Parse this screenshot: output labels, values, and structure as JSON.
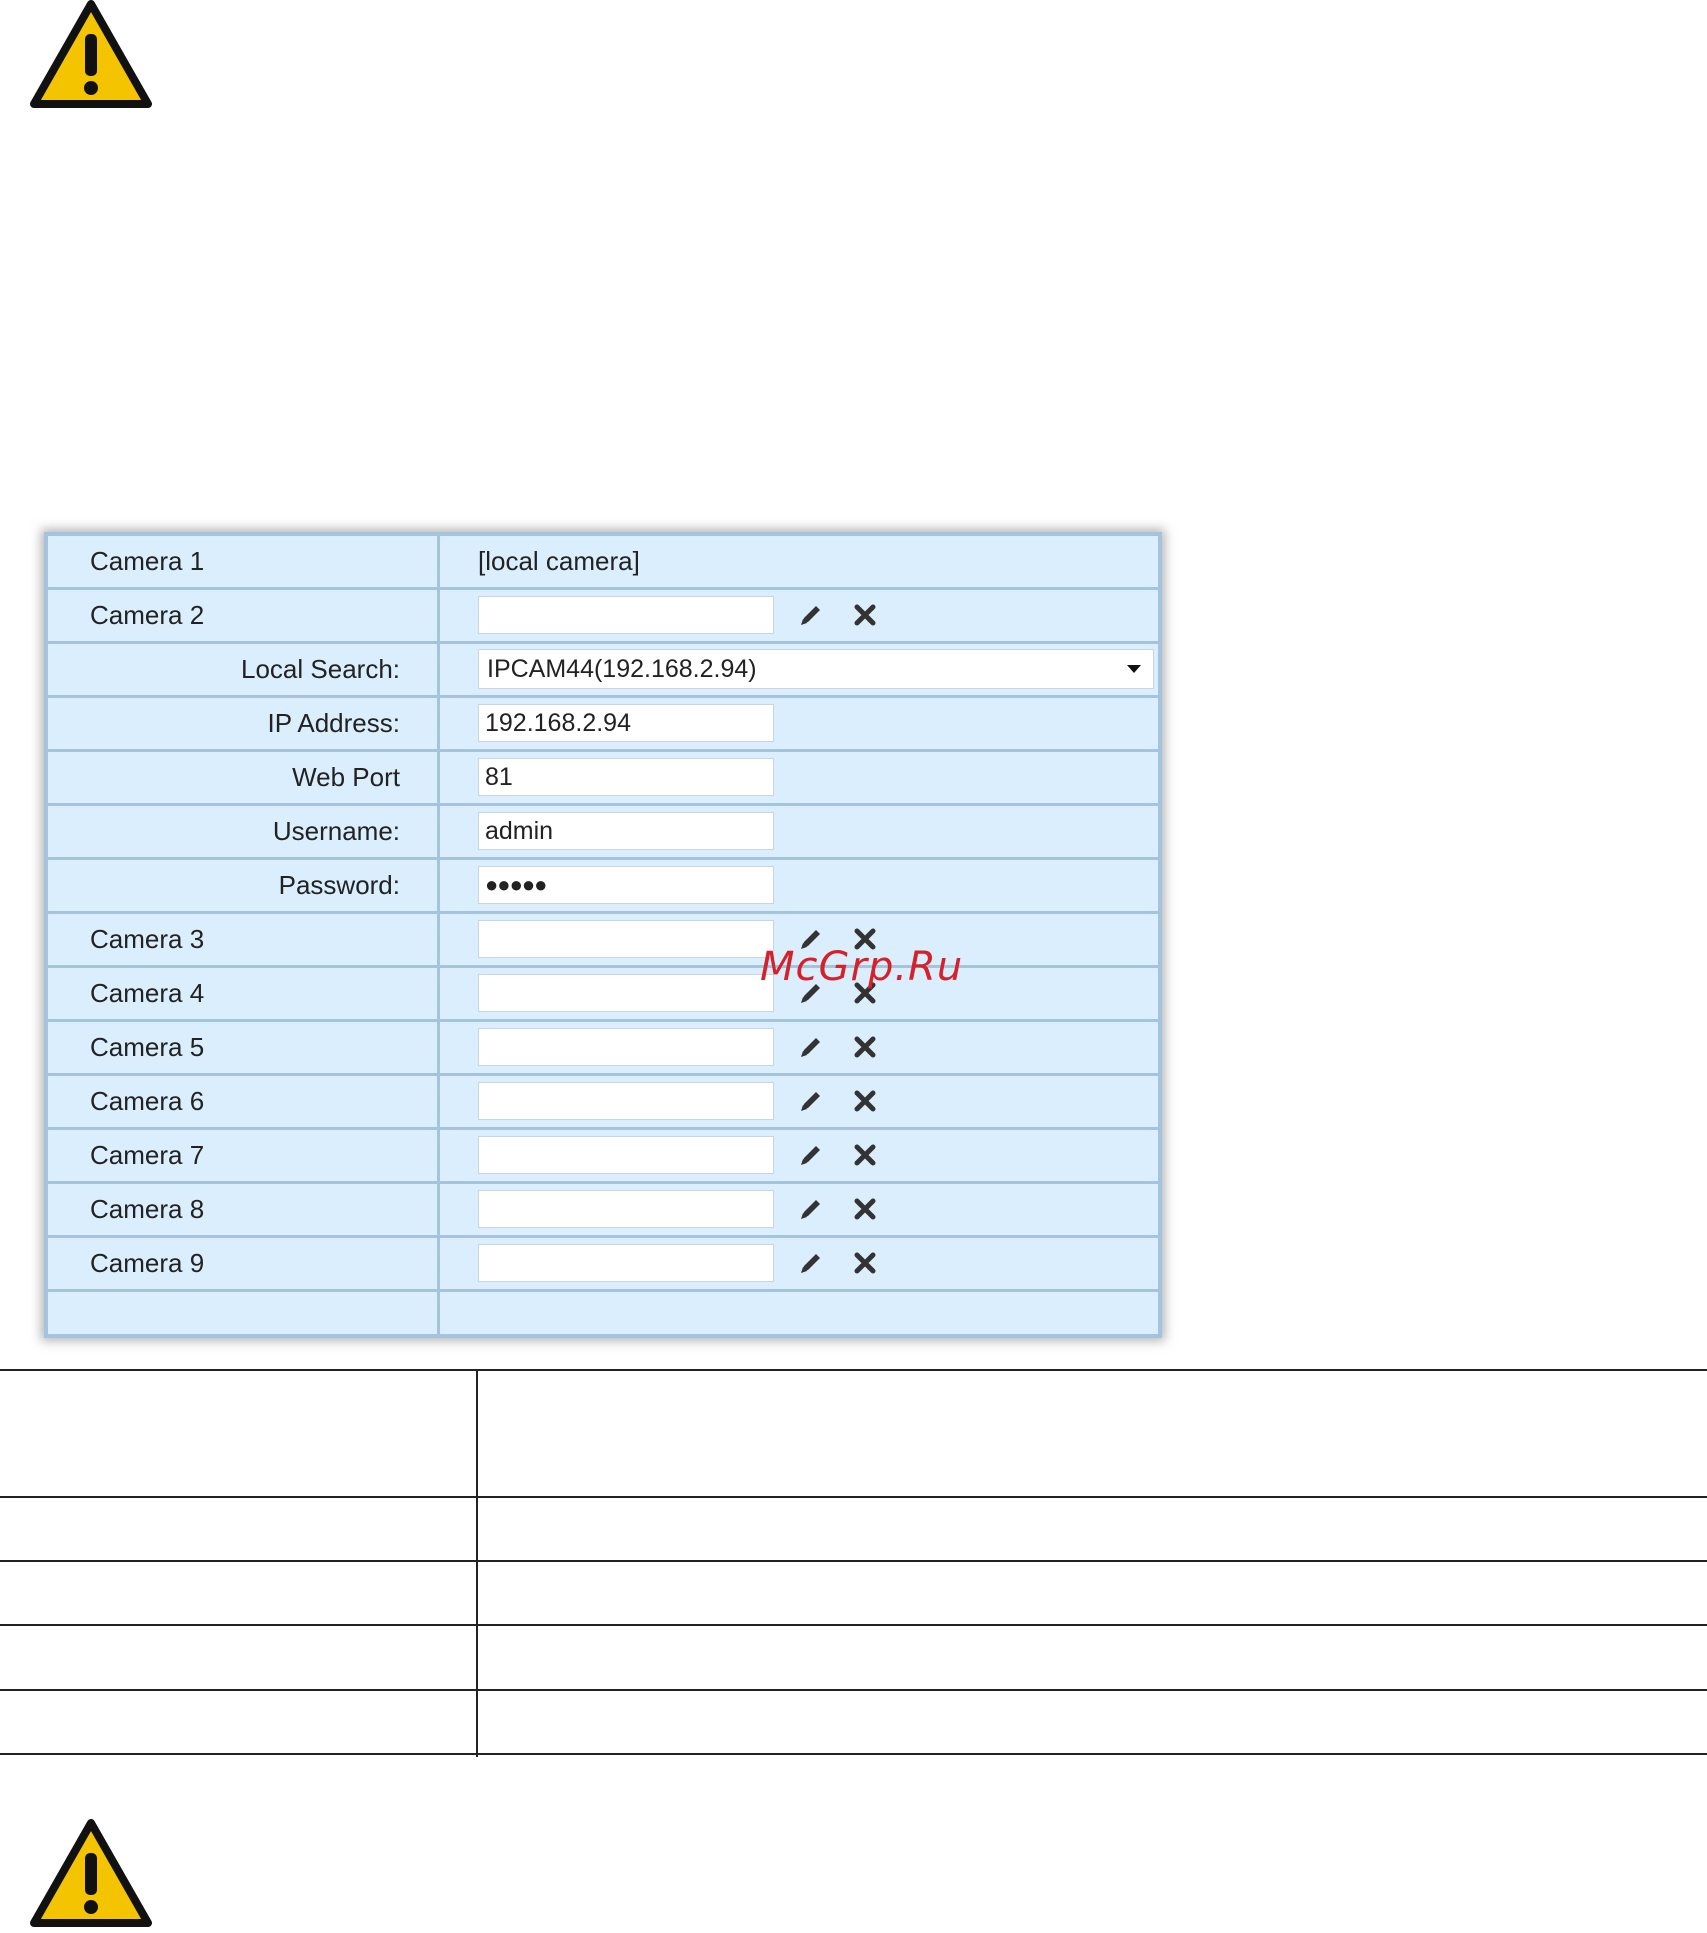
{
  "cameras_panel": {
    "camera1": {
      "label": "Camera 1",
      "value": "[local camera]"
    },
    "camera2": {
      "label": "Camera 2",
      "value": ""
    },
    "local_search": {
      "label": "Local Search:",
      "selected": "IPCAM44(192.168.2.94)"
    },
    "ip_address": {
      "label": "IP Address:",
      "value": "192.168.2.94"
    },
    "web_port": {
      "label": "Web Port",
      "value": "81"
    },
    "username": {
      "label": "Username:",
      "value": "admin"
    },
    "password": {
      "label": "Password:",
      "value": "●●●●●"
    },
    "other_cameras": [
      {
        "label": "Camera 3",
        "value": ""
      },
      {
        "label": "Camera 4",
        "value": ""
      },
      {
        "label": "Camera 5",
        "value": ""
      },
      {
        "label": "Camera 6",
        "value": ""
      },
      {
        "label": "Camera 7",
        "value": ""
      },
      {
        "label": "Camera 8",
        "value": ""
      },
      {
        "label": "Camera 9",
        "value": ""
      }
    ],
    "icons": {
      "edit": "pencil-icon",
      "delete": "close-icon"
    }
  },
  "watermark": "McGrp.Ru",
  "colors": {
    "panel_bg": "#dbeefd",
    "panel_border": "#a6c3de",
    "warning_yellow": "#f5c400",
    "watermark_red": "#d6202a"
  }
}
